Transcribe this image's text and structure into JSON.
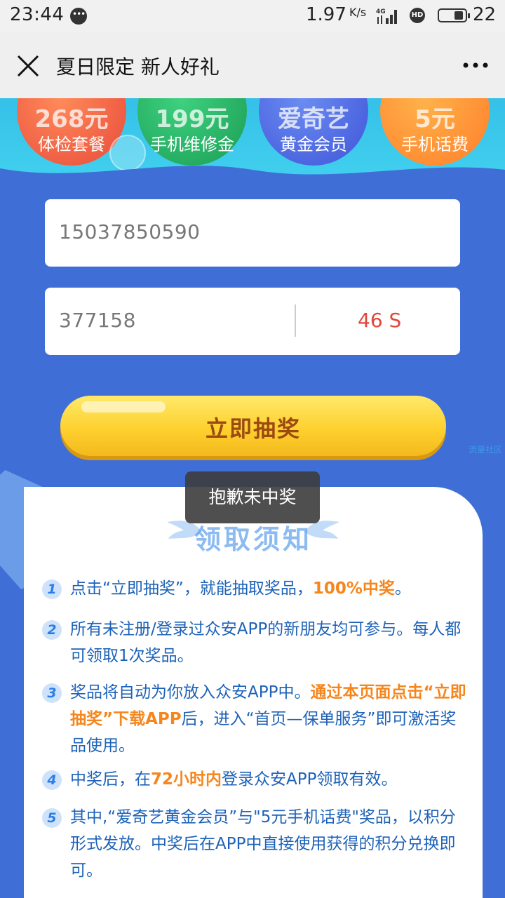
{
  "status_bar": {
    "time": "23:44",
    "speed": "1.97",
    "speed_unit": "K/s",
    "network": "4G",
    "hd": "HD",
    "battery_level": "22"
  },
  "nav": {
    "title": "夏日限定 新人好礼"
  },
  "prizes": [
    {
      "amount": "268元",
      "desc": "体检套餐"
    },
    {
      "amount": "199元",
      "desc": "手机维修金"
    },
    {
      "amount": "爱奇艺",
      "desc": "黄金会员"
    },
    {
      "amount": "5元",
      "desc": "手机话费"
    }
  ],
  "form": {
    "phone": "15037850590",
    "code": "377158",
    "countdown": "46 S",
    "draw_button": "立即抽奖"
  },
  "watermark": "流量社区",
  "toast": "抱歉未中奖",
  "notice": {
    "title": "领取须知",
    "items": [
      {
        "num": "1",
        "t1": "点击“立即抽奖”，就能抽取奖品，",
        "h1": "100%中奖",
        "t2": "。"
      },
      {
        "num": "2",
        "t1": "所有未注册/登录过众安APP的新朋友均可参与。每人都可领取1次奖品。"
      },
      {
        "num": "3",
        "t1": "奖品将自动为你放入众安APP中。",
        "h1": "通过本页面点击“立即抽奖”下载APP",
        "t2": "后，进入“首页—保单服务”即可激活奖品使用。"
      },
      {
        "num": "4",
        "t1": "中奖后，在",
        "h1": "72小时内",
        "t2": "登录众安APP领取有效。"
      },
      {
        "num": "5",
        "t1": "其中,“爱奇艺黄金会员”与\"5元手机话费\"奖品，以积分形式发放。中奖后在APP中直接使用获得的积分兑换即可。"
      }
    ]
  }
}
